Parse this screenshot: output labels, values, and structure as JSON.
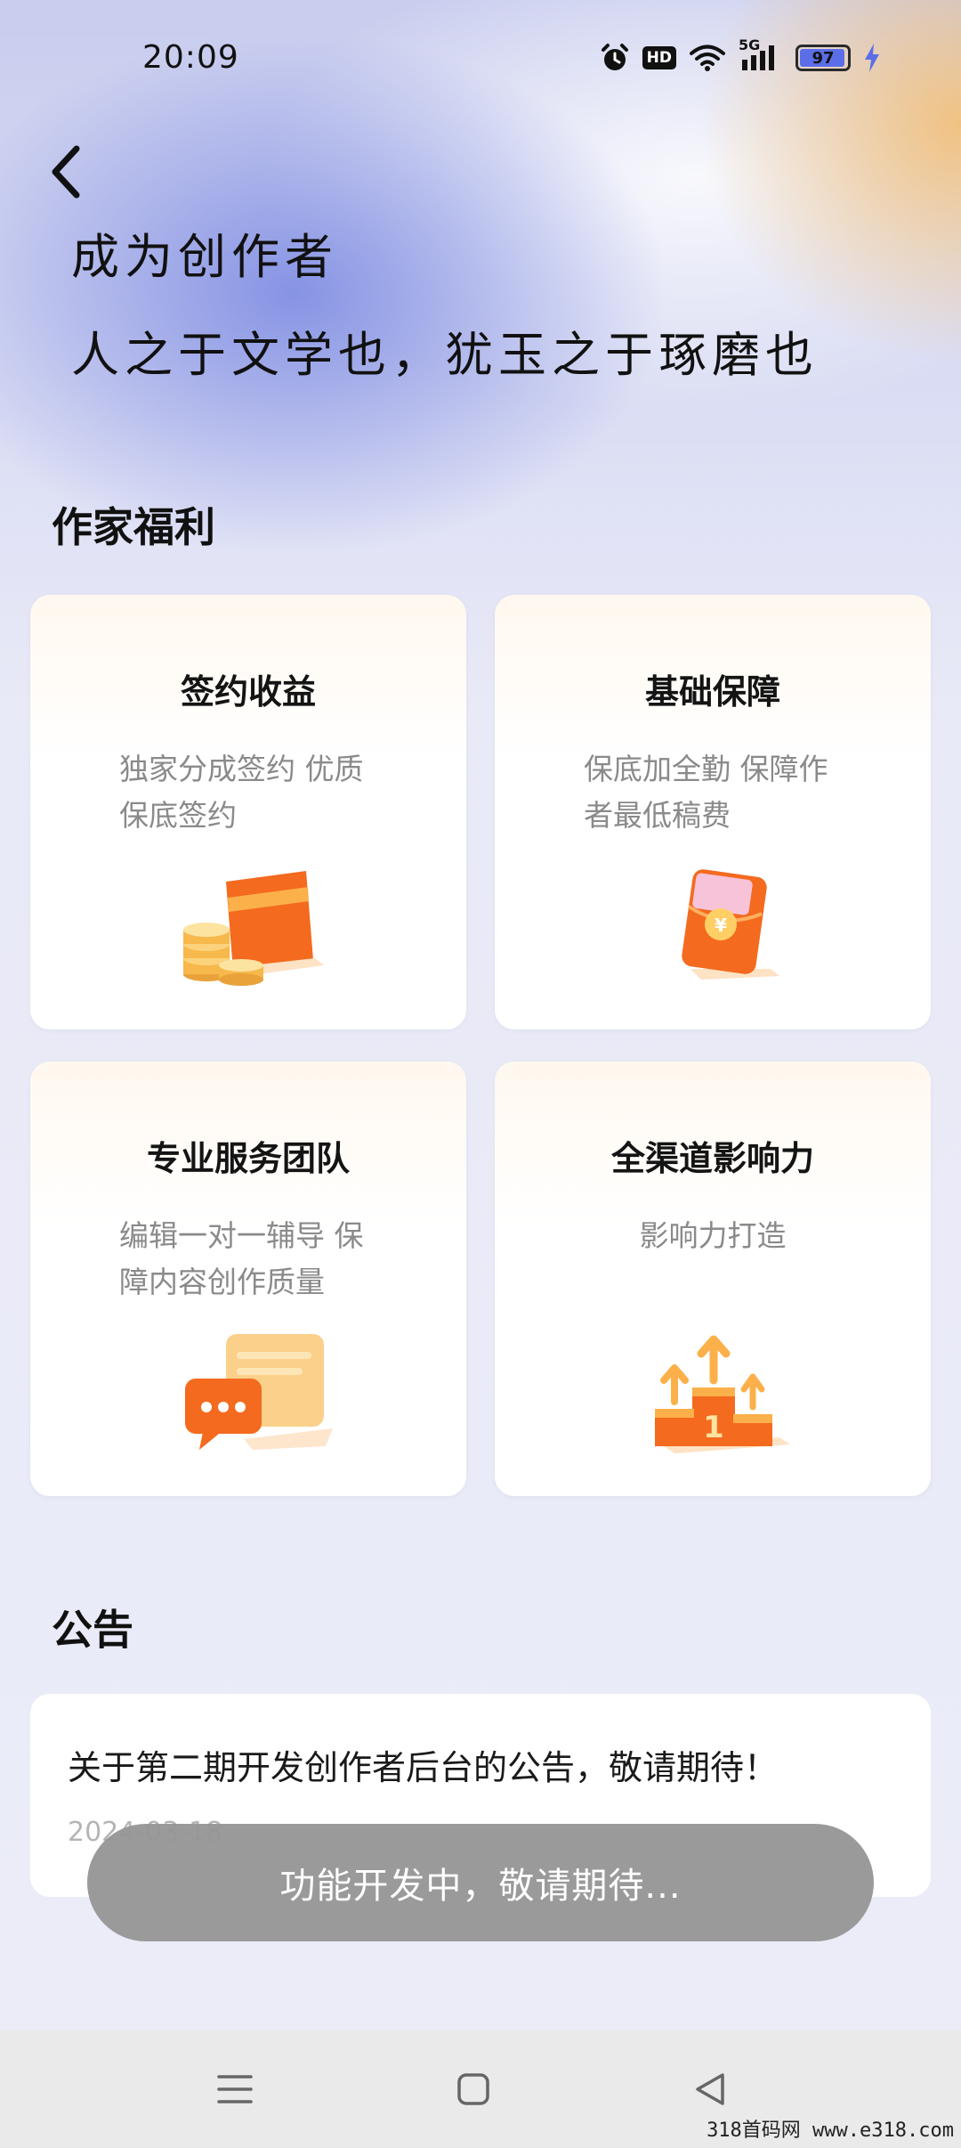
{
  "status_bar": {
    "time": "20:09",
    "hd_label": "HD",
    "network_label": "5G",
    "battery_level": "97",
    "battery_fraction": 0.97,
    "accent": "#5b6ee8"
  },
  "header": {
    "back_icon": "chevron-left-icon",
    "title": "成为创作者",
    "subtitle": "人之于文学也，犹玉之于琢磨也"
  },
  "benefits": {
    "section_title": "作家福利",
    "cards": [
      {
        "title": "签约收益",
        "desc": "独家分成签约  优质保底签约",
        "icon": "card-coins-icon"
      },
      {
        "title": "基础保障",
        "desc": "保底加全勤  保障作者最低稿费",
        "icon": "red-envelope-icon"
      },
      {
        "title": "专业服务团队",
        "desc": "编辑一对一辅导  保障内容创作质量",
        "icon": "chat-bubble-icon"
      },
      {
        "title": "全渠道影响力",
        "desc": "影响力打造",
        "icon": "podium-arrows-icon"
      }
    ]
  },
  "announcements": {
    "section_title": "公告",
    "items": [
      {
        "title": "关于第二期开发创作者后台的公告，敬请期待！",
        "date": "2024-03-18"
      }
    ]
  },
  "toast": {
    "message": "功能开发中，敬请期待..."
  },
  "nav_bar": {
    "buttons": [
      "menu-icon",
      "home-icon",
      "back-triangle-icon"
    ]
  },
  "watermark": "318首码网  www.e318.com",
  "colors": {
    "orange": "#f46a1f",
    "orange_light": "#fbb04a",
    "card_bg": "#ffffff",
    "muted_text": "#8a8a8a"
  }
}
